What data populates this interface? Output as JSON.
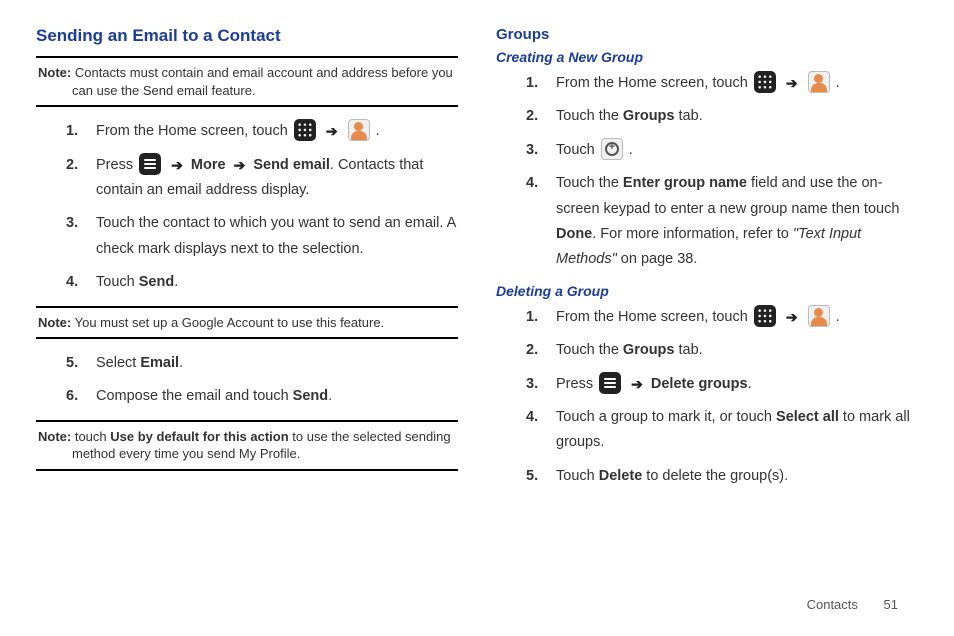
{
  "left": {
    "heading": "Sending an Email to a Contact",
    "note1": {
      "label": "Note:",
      "text": "Contacts must contain and email account and address before you can use the Send email feature."
    },
    "steps_a": {
      "s1a": "From the Home screen, touch ",
      "s1b": ".",
      "s2a": "Press ",
      "s2b": "More",
      "s2c": "Send email",
      "s2d": ". Contacts that contain an email address display.",
      "s3": "Touch the contact to which you want to send an email. A check mark displays next to the selection.",
      "s4a": "Touch ",
      "s4b": "Send",
      "s4c": "."
    },
    "note2": {
      "label": "Note:",
      "text": "You must set up a Google Account to use this feature."
    },
    "steps_b": {
      "s5a": "Select ",
      "s5b": "Email",
      "s5c": ".",
      "s6a": "Compose the email and touch ",
      "s6b": "Send",
      "s6c": "."
    },
    "note3": {
      "label": "Note:",
      "text_a": "touch ",
      "text_b": "Use by default for this action",
      "text_c": " to use the selected sending method every time you send My Profile."
    }
  },
  "right": {
    "heading": "Groups",
    "creating": {
      "heading": "Creating a New Group",
      "s1a": "From the Home screen, touch ",
      "s1b": ".",
      "s2a": "Touch the ",
      "s2b": "Groups",
      "s2c": " tab.",
      "s3a": "Touch ",
      "s3b": ".",
      "s4a": "Touch the ",
      "s4b": "Enter group name",
      "s4c": " field and use the on-screen keypad to enter a new group name then touch ",
      "s4d": "Done",
      "s4e": ". For more information, refer to ",
      "s4f": "\"Text Input Methods\"",
      "s4g": " on page 38."
    },
    "deleting": {
      "heading": "Deleting a Group",
      "s1a": "From the Home screen, touch ",
      "s1b": ".",
      "s2a": "Touch the ",
      "s2b": "Groups",
      "s2c": " tab.",
      "s3a": "Press ",
      "s3b": "Delete groups",
      "s3c": ".",
      "s4a": "Touch a group to mark it, or touch ",
      "s4b": "Select all",
      "s4c": " to mark all groups.",
      "s5a": "Touch ",
      "s5b": "Delete",
      "s5c": " to delete the group(s)."
    }
  },
  "arrow": "➔",
  "footer": {
    "section": "Contacts",
    "page": "51"
  }
}
